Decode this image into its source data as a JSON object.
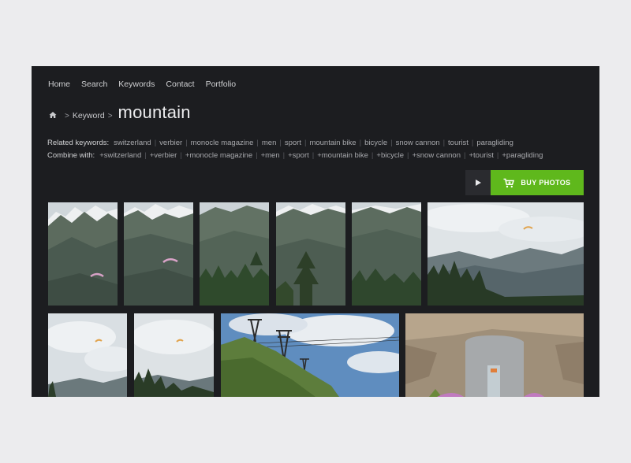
{
  "nav": {
    "items": [
      "Home",
      "Search",
      "Keywords",
      "Contact",
      "Portfolio"
    ]
  },
  "breadcrumb": {
    "home_icon": "home-icon",
    "separator": ">",
    "keyword": "Keyword",
    "current": "mountain"
  },
  "related": {
    "label": "Related keywords:",
    "tags": [
      "switzerland",
      "verbier",
      "monocle magazine",
      "men",
      "sport",
      "mountain bike",
      "bicycle",
      "snow cannon",
      "tourist",
      "paragliding"
    ]
  },
  "combine": {
    "label": "Combine with:",
    "tags": [
      "+switzerland",
      "+verbier",
      "+monocle magazine",
      "+men",
      "+sport",
      "+mountain bike",
      "+bicycle",
      "+snow cannon",
      "+tourist",
      "+paragliding"
    ]
  },
  "actions": {
    "play_icon": "play-icon",
    "cart_icon": "cart-icon",
    "buy_label": "BUY PHOTOS",
    "buy_color": "#5fb81c"
  },
  "colors": {
    "page_bg": "#ececee",
    "panel_bg": "#1c1d20"
  }
}
